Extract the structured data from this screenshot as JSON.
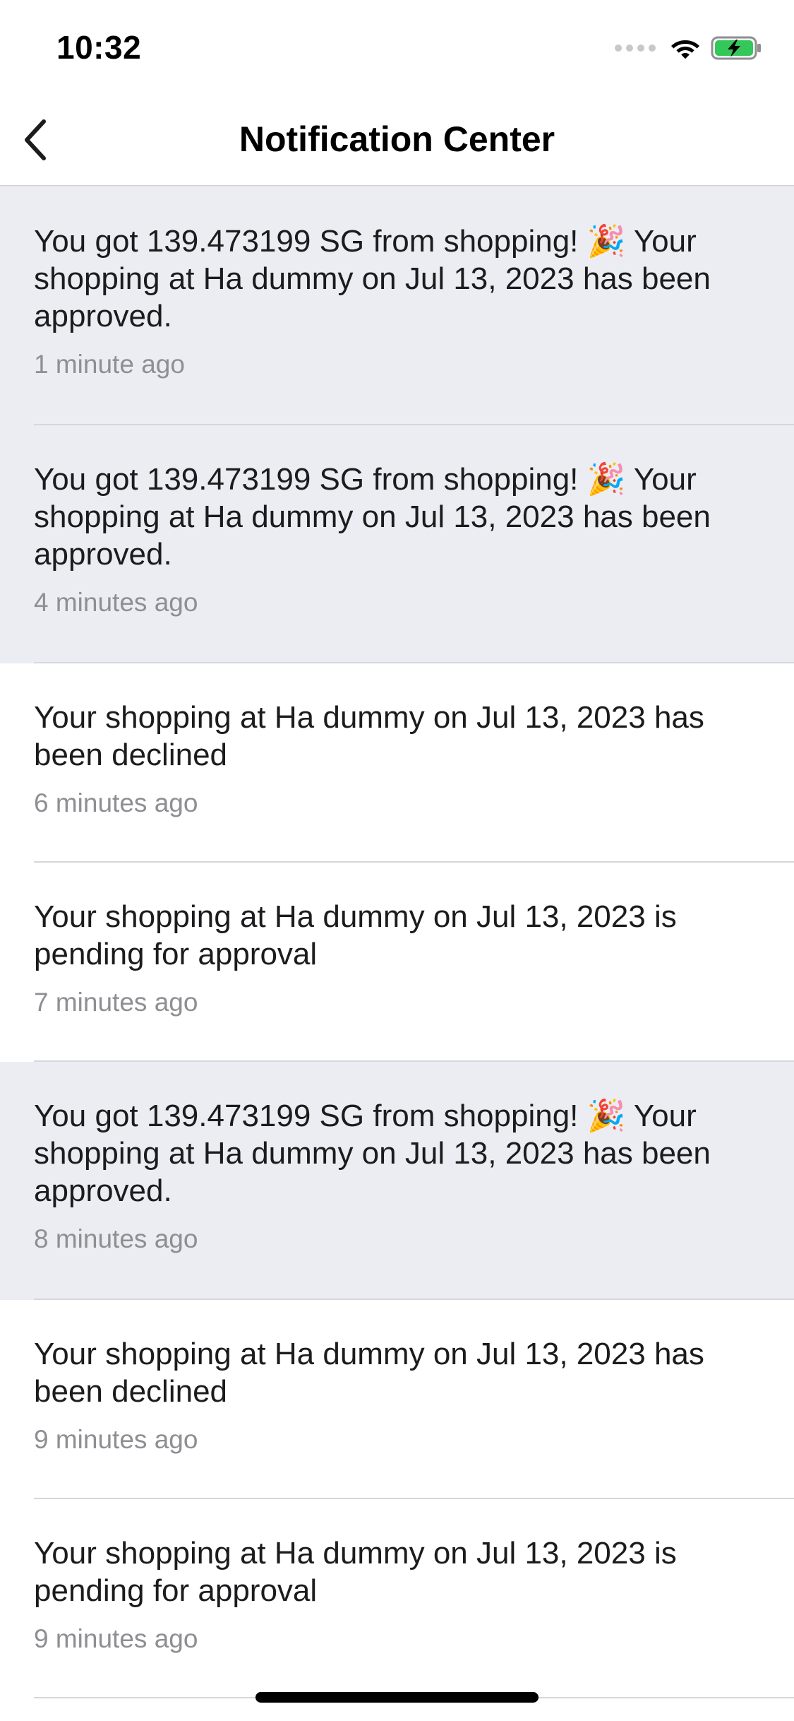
{
  "status_bar": {
    "time": "10:32",
    "icons": [
      "signal-icon",
      "wifi-icon",
      "battery-charging-icon"
    ],
    "battery_color": "#34c759"
  },
  "nav": {
    "back_icon": "chevron-left-icon",
    "title": "Notification Center"
  },
  "colors": {
    "unread_background": "#ecedf2",
    "read_background": "#ffffff",
    "secondary_text": "#8e8e93"
  },
  "notifications": [
    {
      "message": "You got 139.473199 SG from shopping! 🎉 Your shopping at Ha dummy on Jul 13, 2023 has been approved.",
      "time": "1 minute ago",
      "unread": true
    },
    {
      "message": "You got 139.473199 SG from shopping! 🎉 Your shopping at Ha dummy on Jul 13, 2023 has been approved.",
      "time": "4 minutes ago",
      "unread": true
    },
    {
      "message": "Your shopping at Ha dummy on Jul 13, 2023 has been declined",
      "time": "6 minutes ago",
      "unread": false
    },
    {
      "message": "Your shopping at Ha dummy on Jul 13, 2023 is pending for approval",
      "time": "7 minutes ago",
      "unread": false
    },
    {
      "message": "You got 139.473199 SG from shopping! 🎉 Your shopping at Ha dummy on Jul 13, 2023 has been approved.",
      "time": "8 minutes ago",
      "unread": true
    },
    {
      "message": "Your shopping at Ha dummy on Jul 13, 2023 has been declined",
      "time": "9 minutes ago",
      "unread": false
    },
    {
      "message": "Your shopping at Ha dummy on Jul 13, 2023 is pending for approval",
      "time": "9 minutes ago",
      "unread": false
    }
  ]
}
